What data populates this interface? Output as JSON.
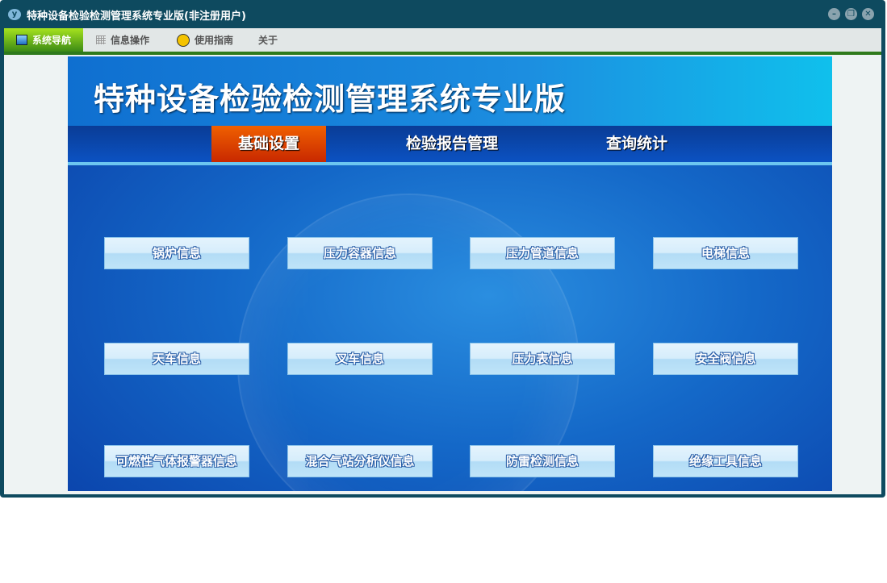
{
  "window": {
    "title": "特种设备检验检测管理系统专业版(非注册用户)"
  },
  "menu": [
    {
      "label": "系统导航",
      "icon": "monitor-icon"
    },
    {
      "label": "信息操作",
      "icon": "grid-icon"
    },
    {
      "label": "使用指南",
      "icon": "help-icon"
    },
    {
      "label": "关于"
    }
  ],
  "banner": {
    "title": "特种设备检验检测管理系统专业版"
  },
  "tabs": [
    "基础设置",
    "检验报告管理",
    "查询统计"
  ],
  "buttons": [
    "锅炉信息",
    "压力容器信息",
    "压力管道信息",
    "电梯信息",
    "天车信息",
    "叉车信息",
    "压力表信息",
    "安全阀信息",
    "可燃性气体报警器信息",
    "混合气站分析仪信息",
    "防雷检测信息",
    "绝缘工具信息"
  ]
}
